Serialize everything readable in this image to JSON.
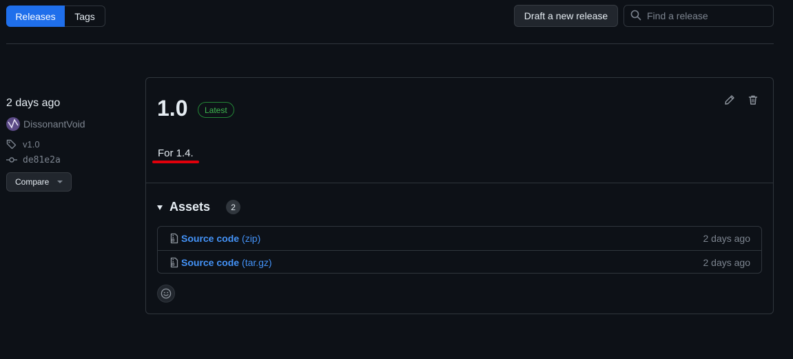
{
  "tabs": {
    "releases": "Releases",
    "tags": "Tags"
  },
  "toolbar": {
    "draft_label": "Draft a new release"
  },
  "search": {
    "placeholder": "Find a release"
  },
  "release": {
    "published": "2 days ago",
    "author": "DissonantVoid",
    "tag": "v1.0",
    "commit": "de81e2a",
    "compare_label": "Compare",
    "title": "1.0",
    "badge": "Latest",
    "body": "For 1.4.",
    "assets_label": "Assets",
    "assets_count": "2",
    "assets": [
      {
        "name": "Source code",
        "ext": "(zip)",
        "time": "2 days ago"
      },
      {
        "name": "Source code",
        "ext": "(tar.gz)",
        "time": "2 days ago"
      }
    ]
  },
  "colors": {
    "background": "#0d1117",
    "accent": "#1f6feb",
    "link": "#4493f8",
    "latest_badge": "#3fb950",
    "annotation_underline": "#e0000b"
  },
  "icons": [
    "search-icon",
    "tag-icon",
    "commit-icon",
    "pencil-icon",
    "trash-icon",
    "file-zip-icon",
    "smiley-icon",
    "triangle-down-icon"
  ]
}
